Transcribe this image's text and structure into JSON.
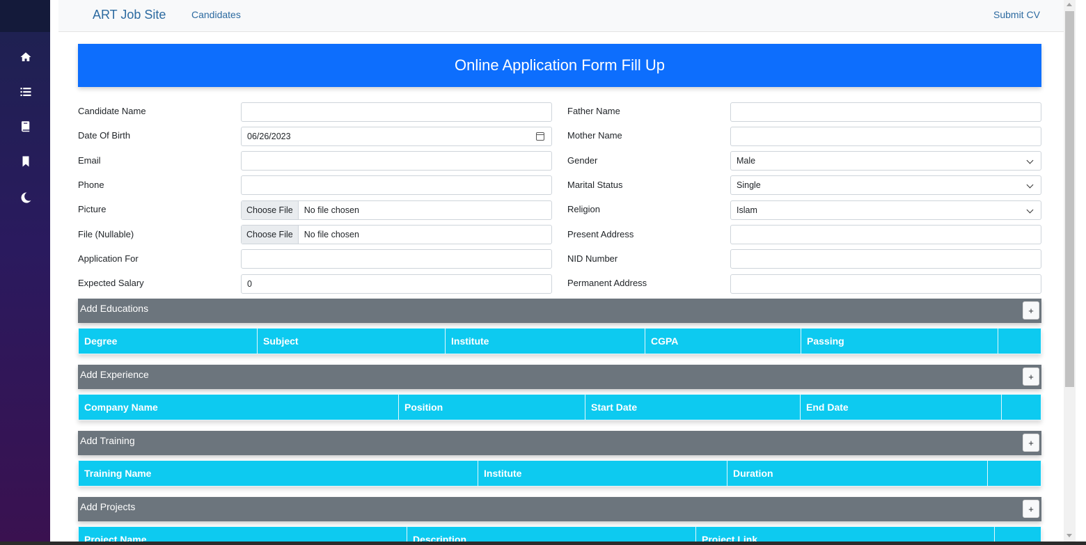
{
  "navbar": {
    "brand": "ART Job Site",
    "candidates_link": "Candidates",
    "submit_cv_link": "Submit CV"
  },
  "sidebar": {
    "icons": [
      "home-icon",
      "list-icon",
      "book-icon",
      "bookmark-icon",
      "moon-icon"
    ]
  },
  "header": {
    "title": "Online Application Form Fill Up"
  },
  "form_left": {
    "candidate_name": {
      "label": "Candidate Name",
      "value": ""
    },
    "dob": {
      "label": "Date Of Birth",
      "value": "06/26/2023"
    },
    "email": {
      "label": "Email",
      "value": ""
    },
    "phone": {
      "label": "Phone",
      "value": ""
    },
    "picture": {
      "label": "Picture",
      "button": "Choose File",
      "status": "No file chosen"
    },
    "file": {
      "label": "File (Nullable)",
      "button": "Choose File",
      "status": "No file chosen"
    },
    "application_for": {
      "label": "Application For",
      "value": ""
    },
    "expected_salary": {
      "label": "Expected Salary",
      "value": "0"
    }
  },
  "form_right": {
    "father_name": {
      "label": "Father Name",
      "value": ""
    },
    "mother_name": {
      "label": "Mother Name",
      "value": ""
    },
    "gender": {
      "label": "Gender",
      "value": "Male"
    },
    "marital_status": {
      "label": "Marital Status",
      "value": "Single"
    },
    "religion": {
      "label": "Religion",
      "value": "Islam"
    },
    "present_address": {
      "label": "Present Address",
      "value": ""
    },
    "nid_number": {
      "label": "NID Number",
      "value": ""
    },
    "permanent_address": {
      "label": "Permanent Address",
      "value": ""
    }
  },
  "sections": {
    "educations": {
      "title": "Add Educations",
      "add": "+",
      "columns": [
        "Degree",
        "Subject",
        "Institute",
        "CGPA",
        "Passing",
        ""
      ]
    },
    "experience": {
      "title": "Add Experience",
      "add": "+",
      "columns": [
        "Company Name",
        "Position",
        "Start Date",
        "End Date",
        ""
      ]
    },
    "training": {
      "title": "Add Training",
      "add": "+",
      "columns": [
        "Training Name",
        "Institute",
        "Duration",
        ""
      ]
    },
    "projects": {
      "title": "Add Projects",
      "add": "+",
      "columns": [
        "Project Name",
        "Description",
        "Project Link",
        ""
      ]
    }
  },
  "colors": {
    "primary": "#0d6efd",
    "info": "#0dcaf0",
    "secondary": "#6c757d",
    "link": "#2c6aa0"
  }
}
